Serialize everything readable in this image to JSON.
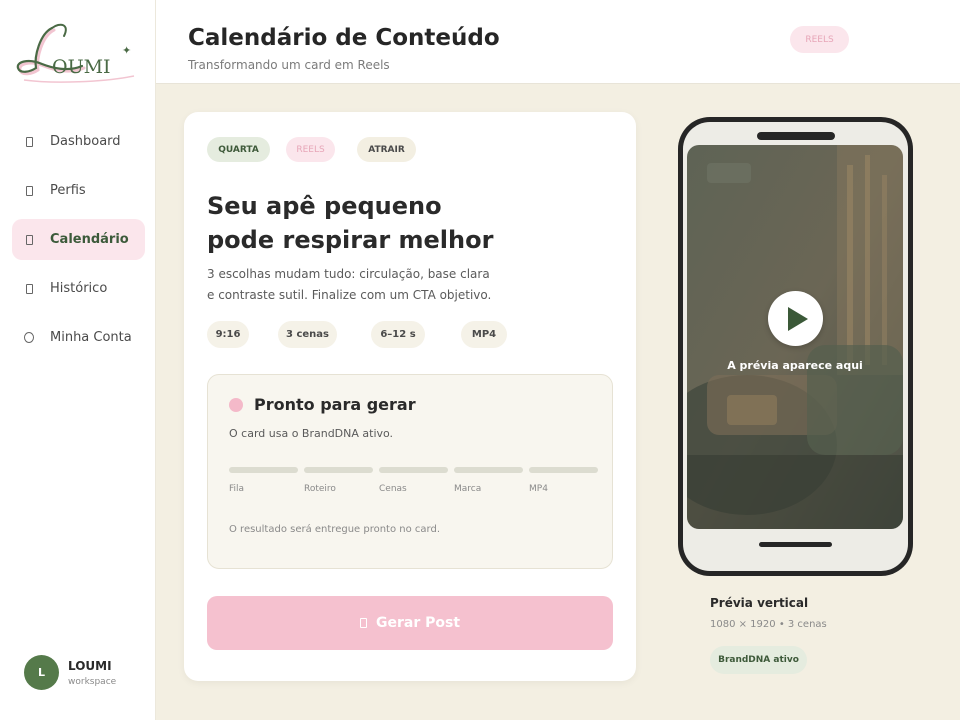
{
  "brand": {
    "logo_text": "LOUMI"
  },
  "sidebar": {
    "items": [
      {
        "label": "Dashboard",
        "icon": "page-icon"
      },
      {
        "label": "Perfis",
        "icon": "page-icon"
      },
      {
        "label": "Calendário",
        "icon": "page-icon",
        "active": true
      },
      {
        "label": "Histórico",
        "icon": "page-icon"
      },
      {
        "label": "Minha Conta",
        "icon": "circle-icon"
      }
    ],
    "user": {
      "initial": "L",
      "name": "LOUMI",
      "role": "workspace"
    }
  },
  "header": {
    "title": "Calendário de Conteúdo",
    "subtitle": "Transformando um card em Reels",
    "badge": "REELS"
  },
  "card": {
    "tags": [
      "QUARTA",
      "REELS",
      "ATRAIR"
    ],
    "headline_line1": "Seu apê pequeno",
    "headline_line2": "pode respirar melhor",
    "desc_line1": "3 escolhas mudam tudo: circulação, base clara",
    "desc_line2": "e contraste sutil. Finalize com um CTA objetivo.",
    "specs": [
      "9:16",
      "3 cenas",
      "6–12 s",
      "MP4"
    ],
    "status": {
      "title": "Pronto para gerar",
      "description": "O card usa o BrandDNA ativo.",
      "steps": [
        "Fila",
        "Roteiro",
        "Cenas",
        "Marca",
        "MP4"
      ],
      "result": "O resultado será entregue pronto no card."
    },
    "generate_button": "Gerar Post"
  },
  "preview": {
    "placeholder": "A prévia aparece aqui",
    "title": "Prévia vertical",
    "meta": "1080 × 1920  •  3 cenas",
    "badge": "BrandDNA ativo"
  },
  "colors": {
    "accent_green": "#3e5a3a",
    "accent_pink": "#f5c1cf",
    "background": "#f3efe2"
  }
}
